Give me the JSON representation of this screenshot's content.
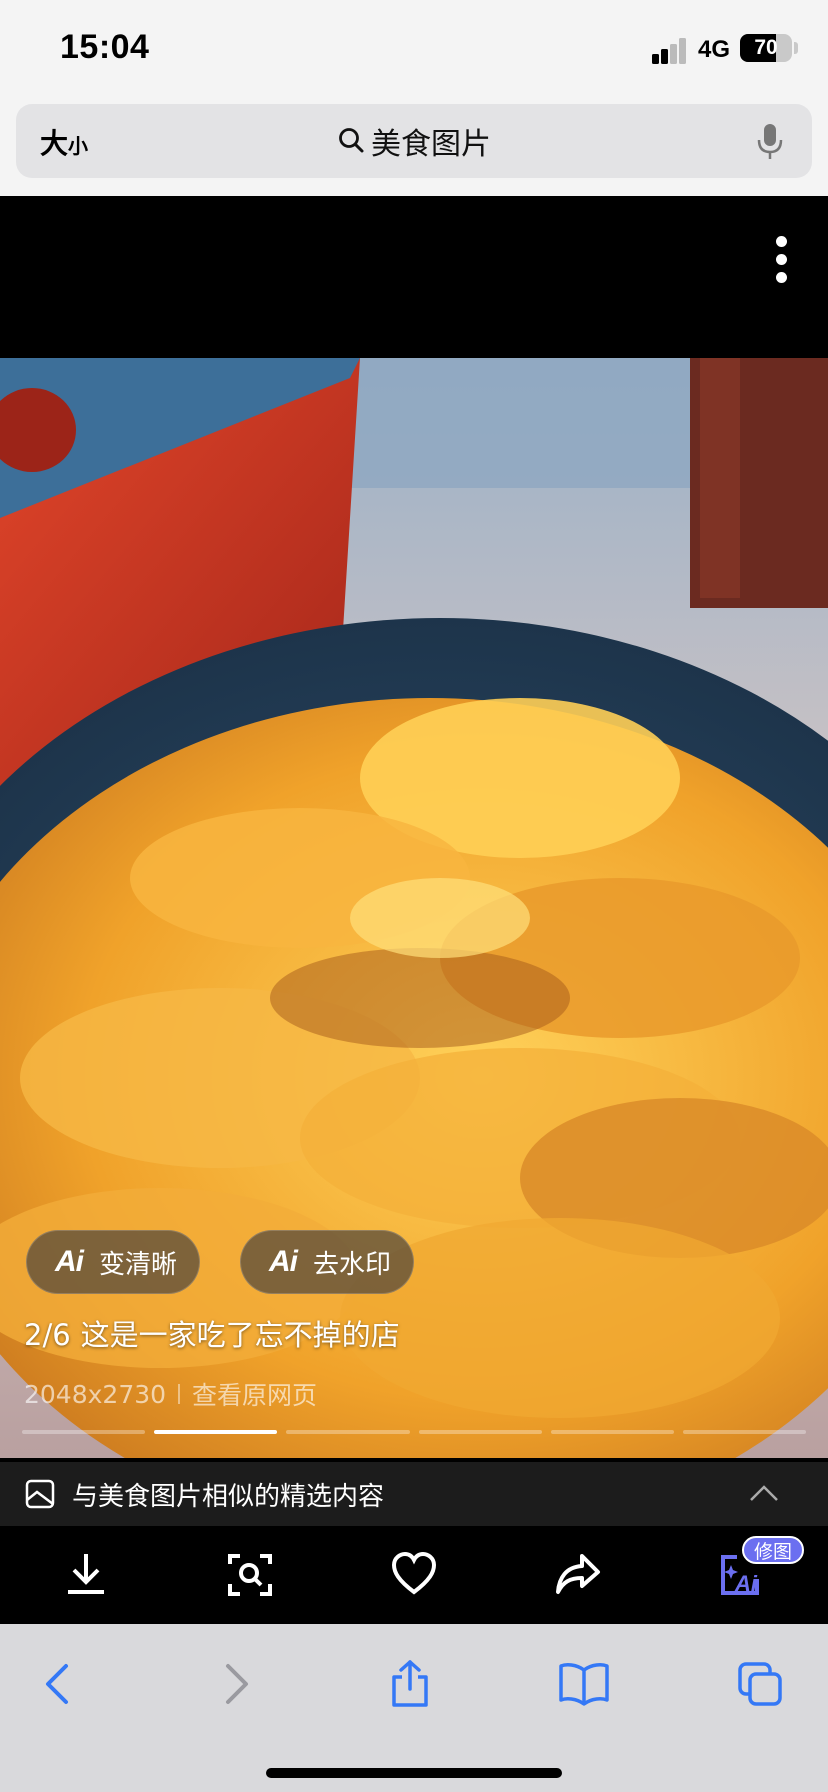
{
  "status_bar": {
    "time": "15:04",
    "network": "4G",
    "battery": "70",
    "battery_level": 0.7
  },
  "url_bar": {
    "text_size_big": "大",
    "text_size_small": "小",
    "query": "美食图片",
    "icons": [
      "search-icon",
      "microphone-icon"
    ]
  },
  "viewer": {
    "more_icon": "ellipsis-vertical-icon",
    "ai_buttons": [
      {
        "logo": "Ai",
        "label": "变清晰"
      },
      {
        "logo": "Ai",
        "label": "去水印"
      }
    ],
    "counter": "2/6",
    "title": "这是一家吃了忘不掉的店",
    "dimensions": "2048x2730",
    "source_link": "查看原网页",
    "pager": {
      "total": 6,
      "current": 2
    }
  },
  "similar": {
    "label": "与美食图片相似的精选内容",
    "icon": "image-icon",
    "toggle_icon": "chevron-up-icon"
  },
  "actions": {
    "icons": [
      "download-icon",
      "image-search-icon",
      "heart-icon",
      "share-icon",
      "ai-edit-icon"
    ],
    "edit_badge": "修图",
    "accent": "#6b6ff0"
  },
  "safari_toolbar": {
    "icons": [
      "back-icon",
      "forward-icon",
      "share-icon",
      "bookmarks-icon",
      "tabs-icon"
    ],
    "tint": "#3478f6"
  }
}
